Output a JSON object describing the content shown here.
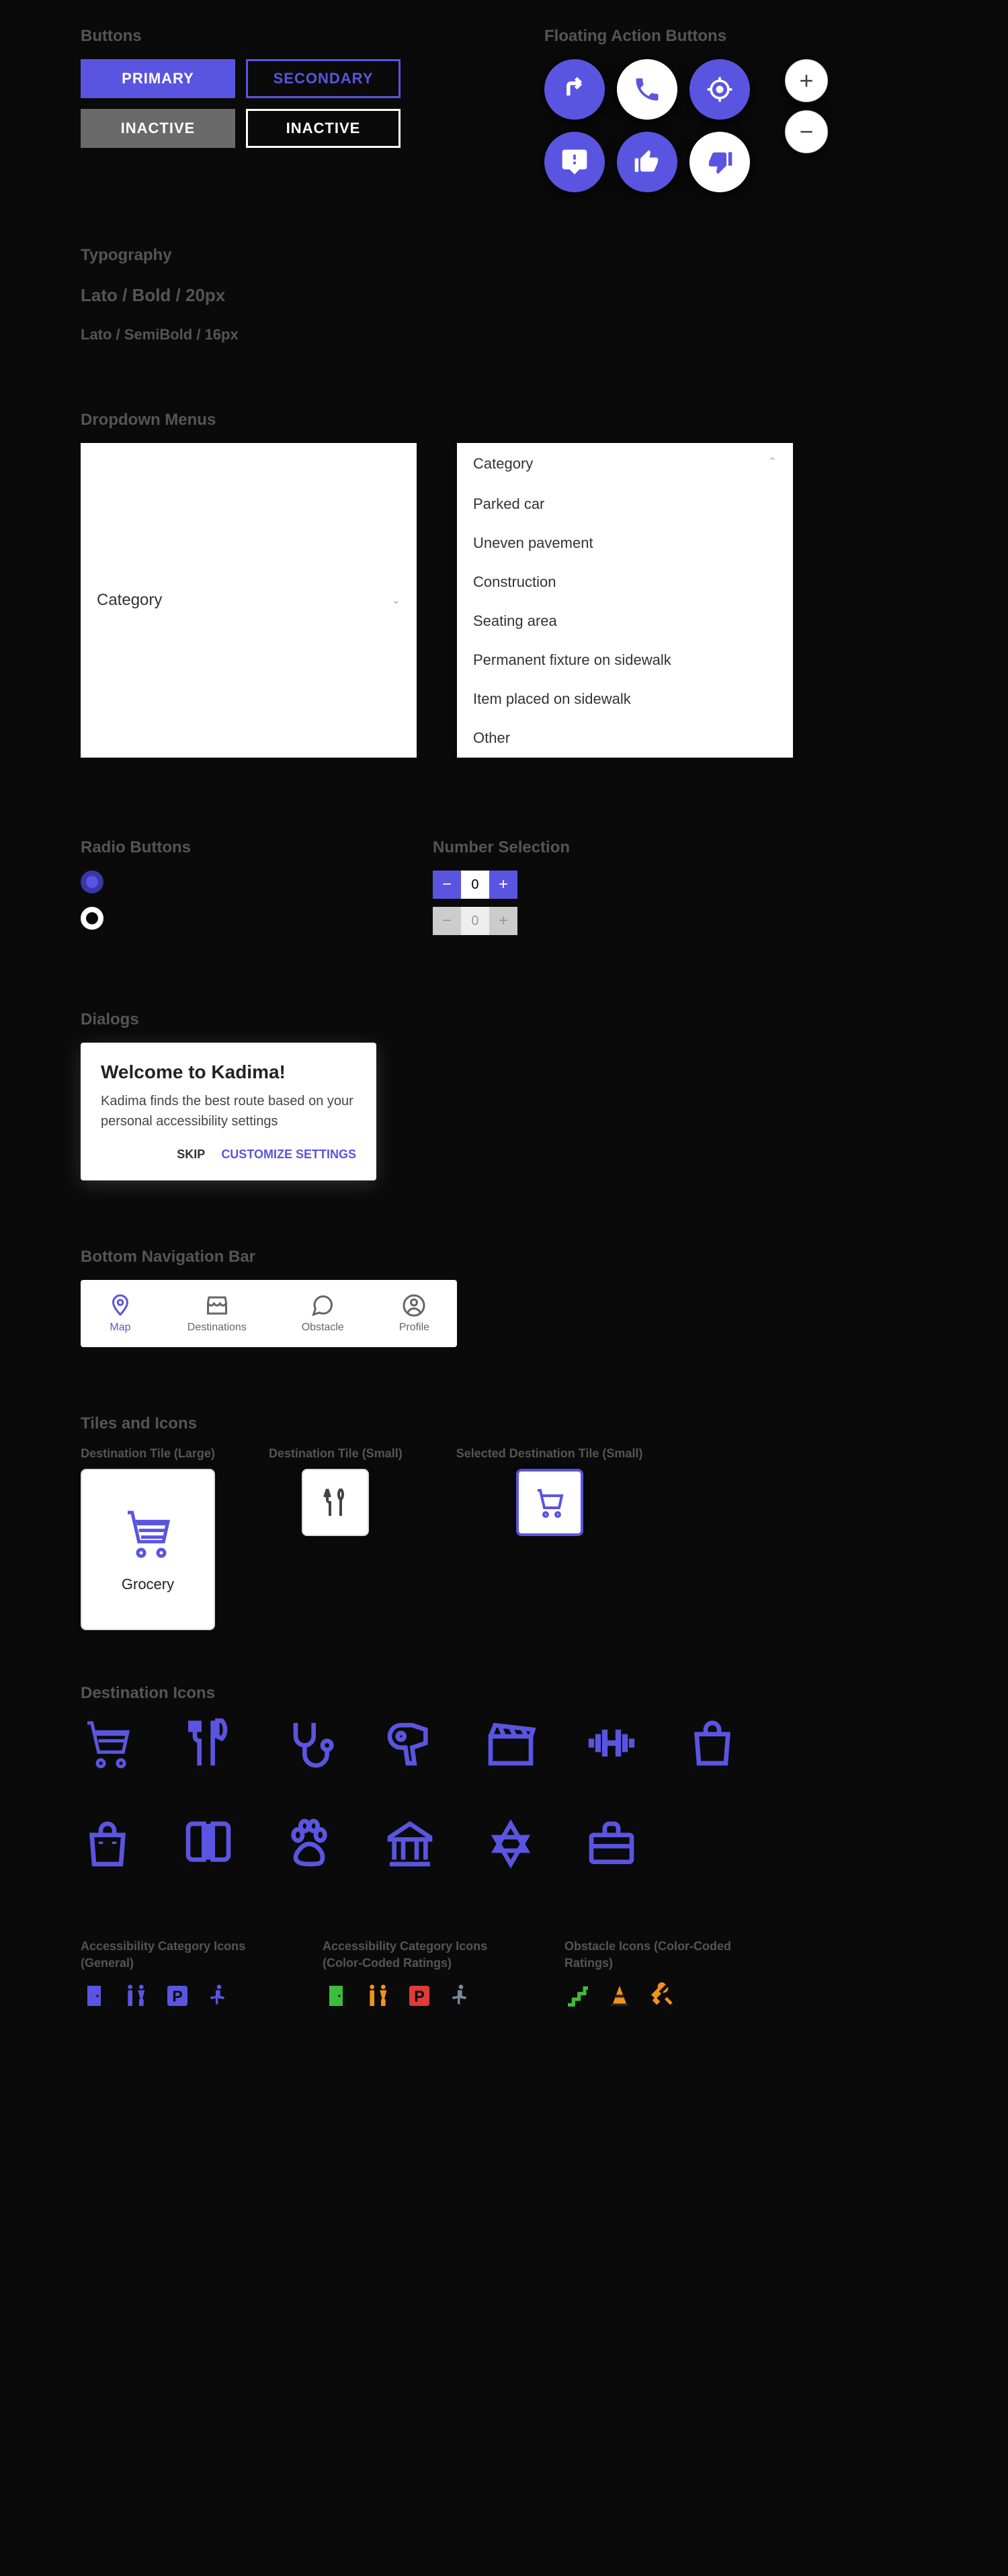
{
  "sections": {
    "buttons": "Buttons",
    "fabs": "Floating Action Buttons",
    "typography": "Typography",
    "dropdowns": "Dropdown Menus",
    "radio": "Radio Buttons",
    "number": "Number Selection",
    "dialogs": "Dialogs",
    "bottomnav": "Bottom Navigation Bar",
    "tiles": "Tiles and Icons",
    "destIcons": "Destination Icons",
    "accGeneral": "Accessibility Category Icons (General)",
    "accColor": "Accessibility Category Icons (Color-Coded Ratings)",
    "obstacleColor": "Obstacle Icons (Color-Coded Ratings)"
  },
  "buttons": {
    "primary": "PRIMARY",
    "secondary": "SECONDARY",
    "inactive1": "INACTIVE",
    "inactive2": "INACTIVE"
  },
  "typography": {
    "sample1": "Lato / Bold / 20px",
    "sample2": "Lato / SemiBold / 16px"
  },
  "dropdown": {
    "label": "Category",
    "items": [
      "Parked car",
      "Uneven pavement",
      "Construction",
      "Seating area",
      "Permanent fixture on sidewalk",
      "Item placed on sidewalk",
      "Other"
    ]
  },
  "numberSelection": {
    "valueActive": "0",
    "valueInactive": "0"
  },
  "dialog": {
    "title": "Welcome to Kadima!",
    "body": "Kadima finds the best route based on your personal accessibility settings",
    "skip": "SKIP",
    "customize": "CUSTOMIZE SETTINGS"
  },
  "bottomnav": {
    "items": [
      {
        "label": "Map",
        "icon": "pin-icon",
        "active": true
      },
      {
        "label": "Destinations",
        "icon": "storefront-icon",
        "active": false
      },
      {
        "label": "Obstacle",
        "icon": "chat-icon",
        "active": false
      },
      {
        "label": "Profile",
        "icon": "user-icon",
        "active": false
      }
    ]
  },
  "tiles": {
    "largeLabel": "Destination Tile (Large)",
    "smallLabel": "Destination Tile (Small)",
    "selectedLabel": "Selected Destination Tile (Small)",
    "grocery": "Grocery"
  },
  "destinationIcons": [
    "cart-icon",
    "utensils-icon",
    "stethoscope-icon",
    "hairdryer-icon",
    "clapperboard-icon",
    "dumbbell-icon",
    "shopping-bag-icon",
    "shopping-bag-icon",
    "book-icon",
    "paw-icon",
    "bank-icon",
    "star-of-david-icon",
    "briefcase-icon"
  ],
  "accessibilityGeneralIcons": [
    "door-icon",
    "restroom-icon",
    "parking-icon",
    "accessible-icon"
  ],
  "accessibilityColorIcons": [
    "door-icon",
    "restroom-icon",
    "parking-icon",
    "accessible-icon"
  ],
  "obstacleColorIcons": [
    "stairs-icon",
    "cone-icon",
    "tools-icon"
  ],
  "colors": {
    "primary": "#5a55e0",
    "green": "#3cbe3c",
    "orange": "#f0931a",
    "red": "#e03a3a"
  }
}
